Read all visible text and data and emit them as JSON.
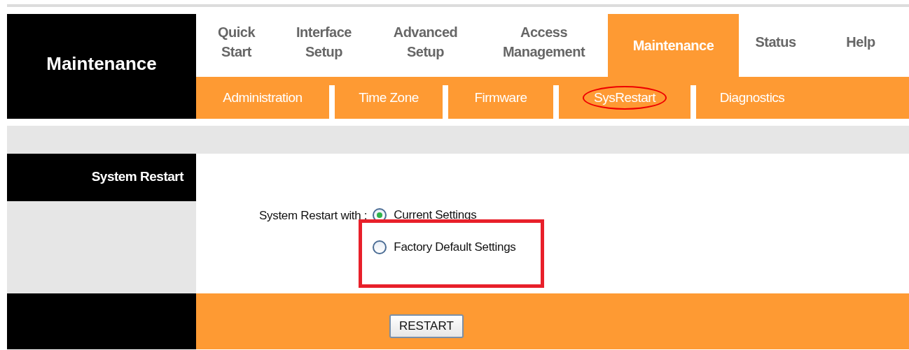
{
  "section_title": "Maintenance",
  "tabs": [
    {
      "label": "Quick\nStart",
      "selected": false
    },
    {
      "label": "Interface\nSetup",
      "selected": false
    },
    {
      "label": "Advanced\nSetup",
      "selected": false
    },
    {
      "label": "Access\nManagement",
      "selected": false
    },
    {
      "label": "Maintenance",
      "selected": true
    },
    {
      "label": "Status",
      "selected": false
    },
    {
      "label": "Help",
      "selected": false
    }
  ],
  "subtabs": [
    {
      "label": "Administration",
      "circled": false
    },
    {
      "label": "Time Zone",
      "circled": false
    },
    {
      "label": "Firmware",
      "circled": false
    },
    {
      "label": "SysRestart",
      "circled": true
    },
    {
      "label": "Diagnostics",
      "circled": false
    }
  ],
  "panel_title": "System Restart",
  "restart_label": "System Restart with :",
  "options": [
    {
      "label": "Current Settings",
      "selected": true,
      "boxed": false
    },
    {
      "label": "Factory Default Settings",
      "selected": false,
      "boxed": true
    }
  ],
  "button": "RESTART"
}
